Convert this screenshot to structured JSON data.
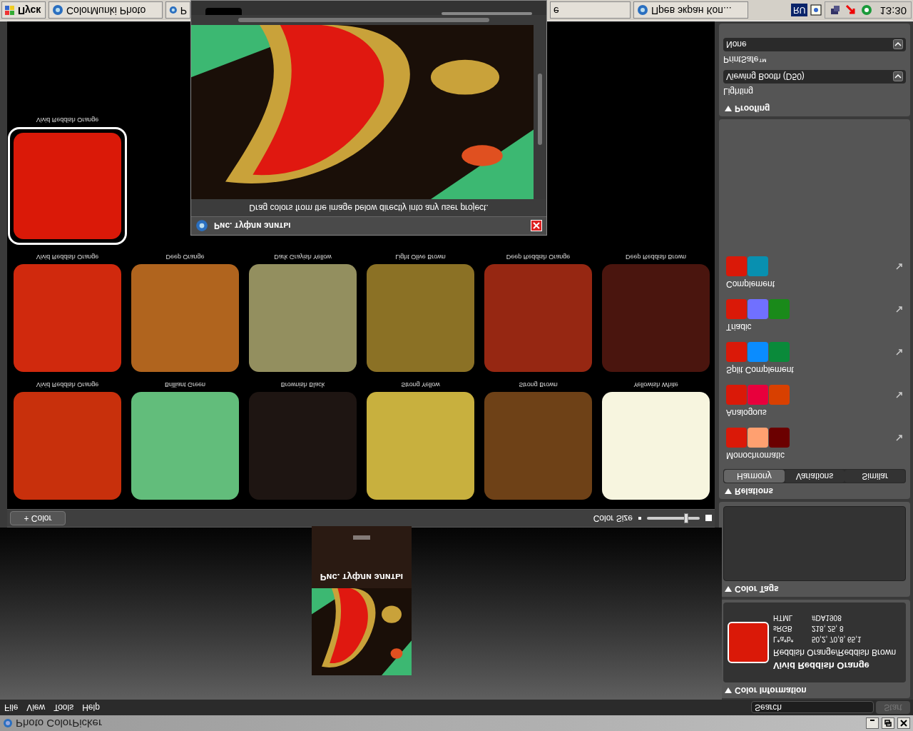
{
  "window": {
    "title": "Photo ColorPicker"
  },
  "menu": [
    "File",
    "View",
    "Tools",
    "Help"
  ],
  "search": {
    "placeholder": "Search"
  },
  "start_button": {
    "label": "Start",
    "disabled": true
  },
  "thumbnail": {
    "title": "Рис. туфли элиты"
  },
  "toolbar": {
    "add_button": "+ Color",
    "size_label": "Color Size",
    "level": 0.74
  },
  "swatch_rows": [
    [
      {
        "name": "Vivid Reddish Orange",
        "color": "#da1908",
        "selected": true
      }
    ],
    [
      {
        "name": "Vivid Reddish Orange",
        "color": "#d0290d",
        "selected": false
      },
      {
        "name": "Deep Orange",
        "color": "#b0641e",
        "selected": false
      },
      {
        "name": "Dark Grayish Yellow",
        "color": "#938f5f",
        "selected": false
      },
      {
        "name": "Light Olive Brown",
        "color": "#8b7125",
        "selected": false
      },
      {
        "name": "Deep Reddish Orange",
        "color": "#962712",
        "selected": false
      },
      {
        "name": "Deep Reddish Brown",
        "color": "#4a150e",
        "selected": false
      }
    ],
    [
      {
        "name": "Vivid Reddish Orange",
        "color": "#c8300c",
        "selected": false
      },
      {
        "name": "Brilliant Green",
        "color": "#62bd7b",
        "selected": false
      },
      {
        "name": "Brownish Black",
        "color": "#1e1512",
        "selected": false
      },
      {
        "name": "Strong Yellow",
        "color": "#c8b03e",
        "selected": false
      },
      {
        "name": "Strong Brown",
        "color": "#6e4117",
        "selected": false
      },
      {
        "name": "Yellowish White",
        "color": "#f7f5df",
        "selected": false
      }
    ]
  ],
  "color_information": {
    "header": "Color Information",
    "expanded": true,
    "color": "#da1908",
    "name": "Vivid Reddish Orange",
    "family": "Reddish Orange/Reddish Brown",
    "values": [
      {
        "label": "HTML",
        "value": "#DA1908"
      },
      {
        "label": "sRGB",
        "value": "218, 25, 8"
      },
      {
        "label": "L*a*b*",
        "value": "50,2, 70,8, 65,1"
      }
    ]
  },
  "color_tags": {
    "header": "Color Tags",
    "expanded": true
  },
  "relations": {
    "header": "Relations",
    "expanded": true,
    "tabs": [
      {
        "label": "Harmony",
        "selected": true
      },
      {
        "label": "Variations",
        "selected": false
      },
      {
        "label": "Similar",
        "selected": false
      }
    ],
    "harmonies": [
      {
        "name": "Complement",
        "colors": [
          {
            "color": "#da1908"
          },
          {
            "color": "#0890b0"
          }
        ]
      },
      {
        "name": "Triadic",
        "colors": [
          {
            "color": "#da1908"
          },
          {
            "color": "#7070ff"
          },
          {
            "color": "#1a8a1a"
          }
        ]
      },
      {
        "name": "Split Complement",
        "colors": [
          {
            "color": "#da1908"
          },
          {
            "color": "#0a8cff"
          },
          {
            "color": "#0a8a3a"
          }
        ]
      },
      {
        "name": "Analogous",
        "colors": [
          {
            "color": "#da1908"
          },
          {
            "color": "#e8003c"
          },
          {
            "color": "#d84000"
          }
        ]
      },
      {
        "name": "Monochromatic",
        "colors": [
          {
            "color": "#da1908"
          },
          {
            "color": "#ffa070"
          },
          {
            "color": "#6b0000"
          }
        ]
      }
    ]
  },
  "proofing": {
    "header": "Proofing",
    "expanded": true,
    "fields": [
      {
        "label": "PrintSafe™",
        "value": "None"
      },
      {
        "label": "Lighting",
        "value": "Viewing Booth (D50)"
      }
    ]
  },
  "image_window": {
    "title": "Рис. туфли элиты",
    "hint": "Drag colors from the image below directly into any user project."
  },
  "taskbar": {
    "start": "Пуск",
    "buttons": [
      {
        "label": "ColorMunki Photo",
        "icon": true
      },
      {
        "label": "P",
        "icon": true
      },
      {
        "label": "е",
        "icon": false
      },
      {
        "label": "Прев экран Коп...",
        "icon": true
      }
    ],
    "language": "RU",
    "clock": "13:30"
  }
}
